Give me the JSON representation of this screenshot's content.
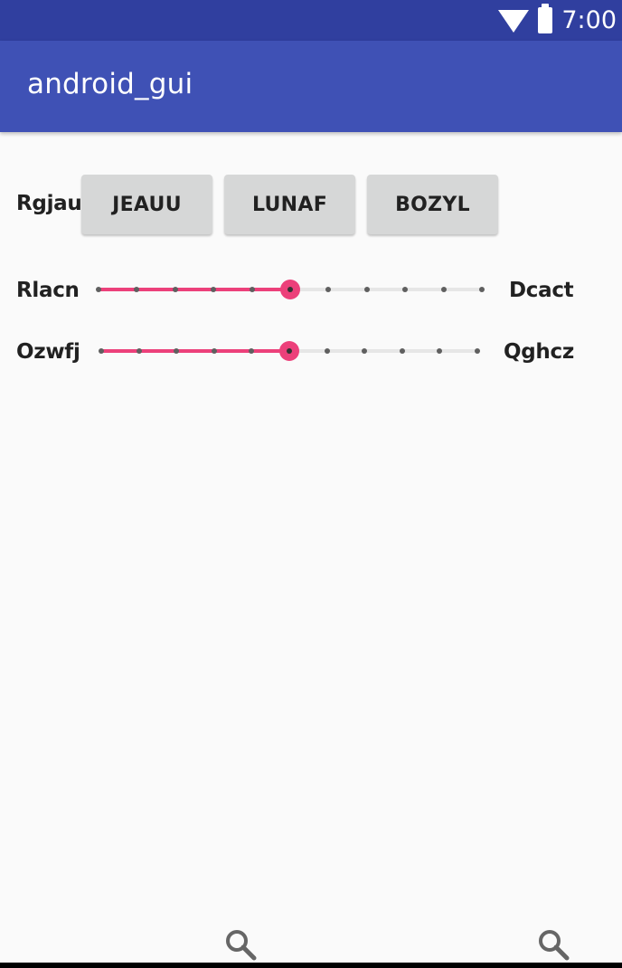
{
  "status_bar": {
    "time": "7:00",
    "icons": [
      "wifi-icon",
      "battery-icon"
    ],
    "background": "#303f9f"
  },
  "app_bar": {
    "title": "android_gui",
    "background": "#3f51b5"
  },
  "button_row": {
    "label": "Rgjau",
    "buttons": [
      {
        "label": "JEAUU"
      },
      {
        "label": "LUNAF"
      },
      {
        "label": "BOZYL"
      }
    ]
  },
  "sliders": [
    {
      "label_left": "Rlacn",
      "label_right": "Dcact",
      "value": 5,
      "max": 10
    },
    {
      "label_left": "Ozwfj",
      "label_right": "Qghcz",
      "value": 5,
      "max": 10
    }
  ],
  "bottom_bar": {
    "icons": [
      "search-icon",
      "search-icon"
    ]
  },
  "colors": {
    "accent": "#ec407a",
    "button_bg": "#d6d7d7",
    "background": "#fafafa"
  }
}
